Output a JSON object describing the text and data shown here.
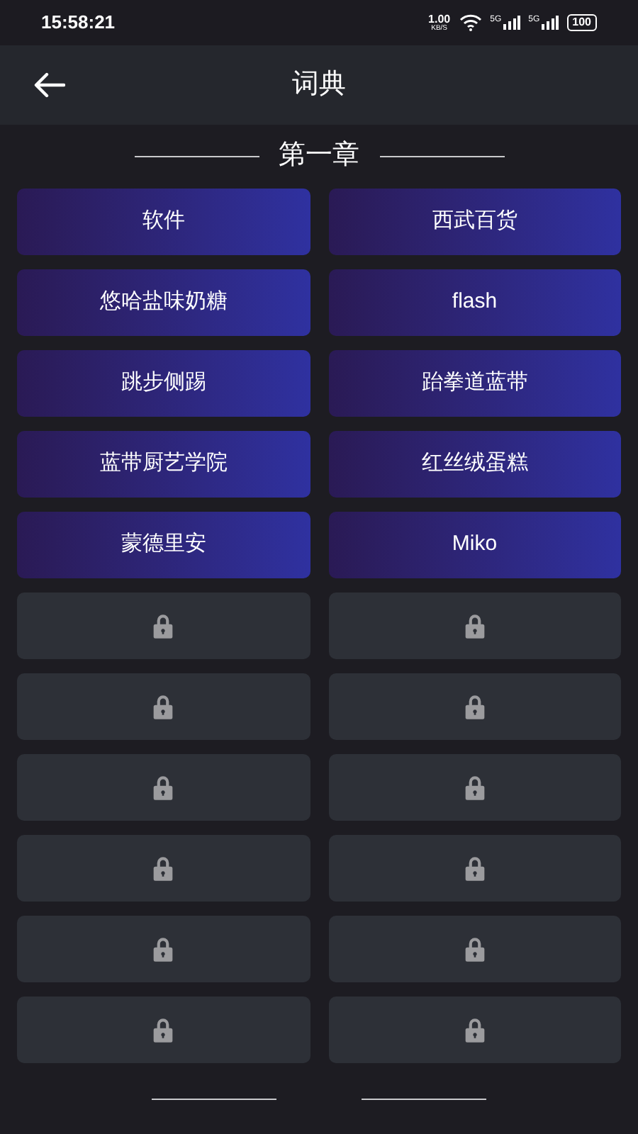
{
  "status_bar": {
    "time": "15:58:21",
    "net_speed": "1.00",
    "net_unit": "KB/S",
    "network_1": "5G",
    "network_2": "5G",
    "battery": "100"
  },
  "header": {
    "title": "词典"
  },
  "chapter": {
    "title": "第一章"
  },
  "entries": [
    {
      "label": "软件",
      "locked": false
    },
    {
      "label": "西武百货",
      "locked": false
    },
    {
      "label": "悠哈盐味奶糖",
      "locked": false
    },
    {
      "label": "flash",
      "locked": false
    },
    {
      "label": "跳步侧踢",
      "locked": false
    },
    {
      "label": "跆拳道蓝带",
      "locked": false
    },
    {
      "label": "蓝带厨艺学院",
      "locked": false
    },
    {
      "label": "红丝绒蛋糕",
      "locked": false
    },
    {
      "label": "蒙德里安",
      "locked": false
    },
    {
      "label": "Miko",
      "locked": false
    },
    {
      "locked": true
    },
    {
      "locked": true
    },
    {
      "locked": true
    },
    {
      "locked": true
    },
    {
      "locked": true
    },
    {
      "locked": true
    },
    {
      "locked": true
    },
    {
      "locked": true
    },
    {
      "locked": true
    },
    {
      "locked": true
    },
    {
      "locked": true
    },
    {
      "locked": true
    }
  ]
}
